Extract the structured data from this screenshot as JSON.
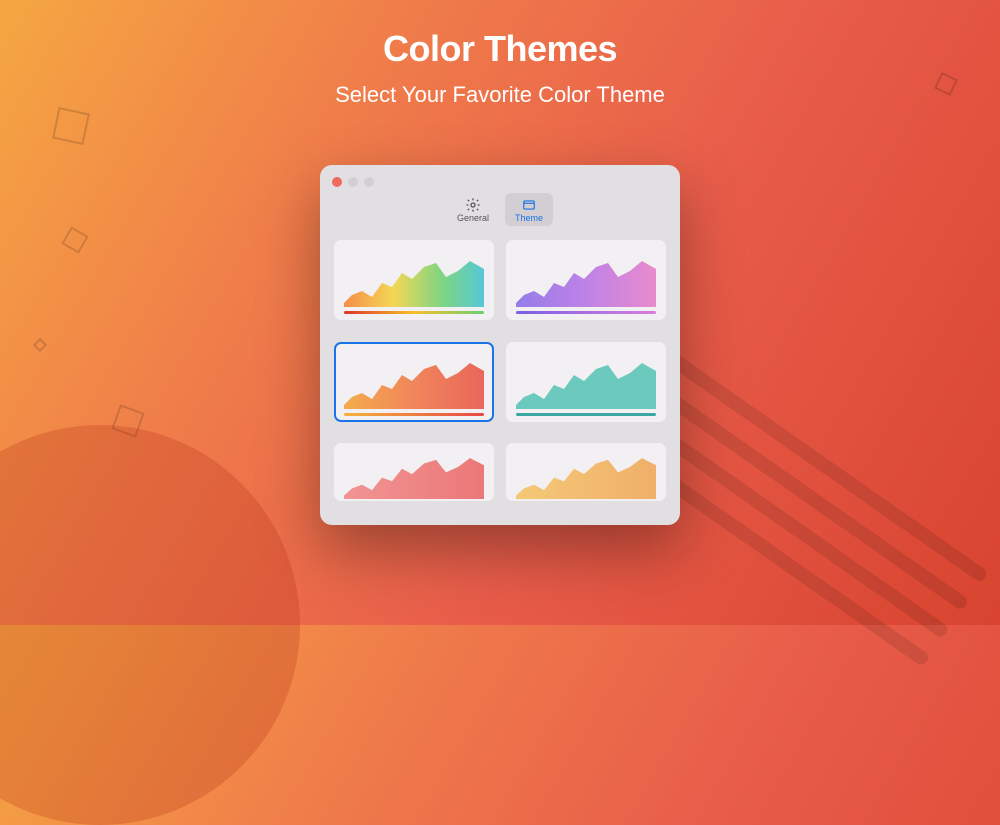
{
  "heading": {
    "title": "Color Themes",
    "subtitle": "Select Your Favorite Color Theme"
  },
  "window": {
    "tabs": [
      {
        "label": "General",
        "icon": "gear-icon",
        "active": false
      },
      {
        "label": "Theme",
        "icon": "window-icon",
        "active": true
      }
    ],
    "themes": [
      {
        "name": "rainbow",
        "gradient_stops": [
          "#f57c2a",
          "#f5d23a",
          "#6ad06e",
          "#3ac1d1"
        ],
        "underline": "linear-gradient(90deg,#e0322a,#f5c12a,#6ad06e)",
        "selected": false
      },
      {
        "name": "violet",
        "gradient_stops": [
          "#8a6fe8",
          "#b976e6",
          "#e87fc8"
        ],
        "underline": "linear-gradient(90deg,#7b5ee6,#d87fdc)",
        "selected": false
      },
      {
        "name": "sunset",
        "gradient_stops": [
          "#f5a43a",
          "#f07a4a",
          "#e8574a"
        ],
        "underline": "linear-gradient(90deg,#f5b23a,#e8484a)",
        "selected": true
      },
      {
        "name": "teal",
        "gradient_stops": [
          "#5cc4b8",
          "#5cc4b8"
        ],
        "underline": "#3aa8a0",
        "selected": false
      },
      {
        "name": "coral",
        "gradient_stops": [
          "#f28a8a",
          "#ea6a6a"
        ],
        "underline": "#e86a6a",
        "selected": false
      },
      {
        "name": "amber",
        "gradient_stops": [
          "#f5c46a",
          "#f0a85a"
        ],
        "underline": "#f0a85a",
        "selected": false
      }
    ]
  }
}
